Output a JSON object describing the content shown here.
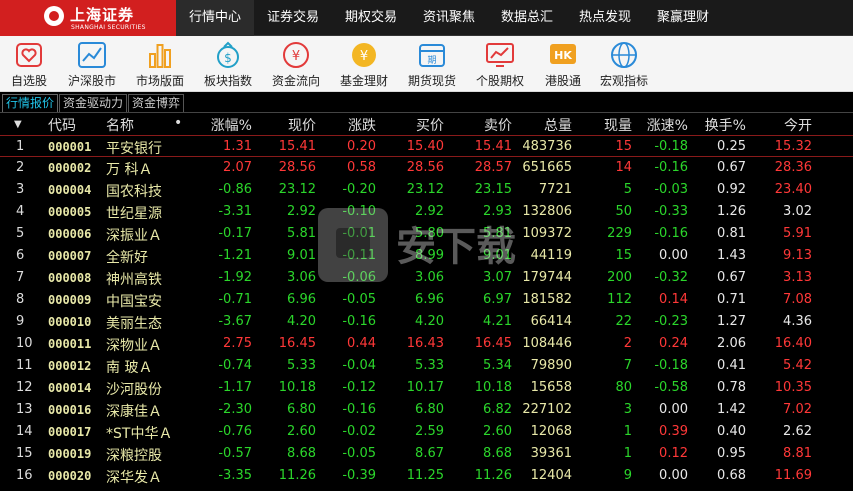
{
  "brand": {
    "name": "上海证券",
    "sub": "SHANGHAI SECURITIES"
  },
  "nav": [
    "行情中心",
    "证券交易",
    "期权交易",
    "资讯聚焦",
    "数据总汇",
    "热点发现",
    "聚赢理财"
  ],
  "toolbar": [
    "自选股",
    "沪深股市",
    "市场版面",
    "板块指数",
    "资金流向",
    "基金理财",
    "期货现货",
    "个股期权",
    "港股通",
    "宏观指标"
  ],
  "subtabs": [
    "行情报价",
    "资金驱动力",
    "资金博弈"
  ],
  "columns": [
    "代码",
    "名称",
    "•",
    "涨幅%",
    "现价",
    "涨跌",
    "买价",
    "卖价",
    "总量",
    "现量",
    "涨速%",
    "换手%",
    "今开"
  ],
  "watermark": "安下载",
  "rows": [
    {
      "idx": "1",
      "code": "000001",
      "name": "平安银行",
      "chg_pct": "1.31",
      "price": "15.41",
      "chg": "0.20",
      "bid": "15.40",
      "ask": "15.41",
      "vol": "483736",
      "cur": "15",
      "speed": "-0.18",
      "turn": "0.25",
      "open": "15.32"
    },
    {
      "idx": "2",
      "code": "000002",
      "name": "万 科Ａ",
      "chg_pct": "2.07",
      "price": "28.56",
      "chg": "0.58",
      "bid": "28.56",
      "ask": "28.57",
      "vol": "651665",
      "cur": "14",
      "speed": "-0.16",
      "turn": "0.67",
      "open": "28.36"
    },
    {
      "idx": "3",
      "code": "000004",
      "name": "国农科技",
      "chg_pct": "-0.86",
      "price": "23.12",
      "chg": "-0.20",
      "bid": "23.12",
      "ask": "23.15",
      "vol": "7721",
      "cur": "5",
      "speed": "-0.03",
      "turn": "0.92",
      "open": "23.40"
    },
    {
      "idx": "4",
      "code": "000005",
      "name": "世纪星源",
      "chg_pct": "-3.31",
      "price": "2.92",
      "chg": "-0.10",
      "bid": "2.92",
      "ask": "2.93",
      "vol": "132806",
      "cur": "50",
      "speed": "-0.33",
      "turn": "1.26",
      "open": "3.02"
    },
    {
      "idx": "5",
      "code": "000006",
      "name": "深振业Ａ",
      "chg_pct": "-0.17",
      "price": "5.81",
      "chg": "-0.01",
      "bid": "5.80",
      "ask": "5.81",
      "vol": "109372",
      "cur": "229",
      "speed": "-0.16",
      "turn": "0.81",
      "open": "5.91"
    },
    {
      "idx": "6",
      "code": "000007",
      "name": "全新好",
      "chg_pct": "-1.21",
      "price": "9.01",
      "chg": "-0.11",
      "bid": "8.99",
      "ask": "9.01",
      "vol": "44119",
      "cur": "15",
      "speed": "0.00",
      "turn": "1.43",
      "open": "9.13"
    },
    {
      "idx": "7",
      "code": "000008",
      "name": "神州高铁",
      "chg_pct": "-1.92",
      "price": "3.06",
      "chg": "-0.06",
      "bid": "3.06",
      "ask": "3.07",
      "vol": "179744",
      "cur": "200",
      "speed": "-0.32",
      "turn": "0.67",
      "open": "3.13"
    },
    {
      "idx": "8",
      "code": "000009",
      "name": "中国宝安",
      "chg_pct": "-0.71",
      "price": "6.96",
      "chg": "-0.05",
      "bid": "6.96",
      "ask": "6.97",
      "vol": "181582",
      "cur": "112",
      "speed": "0.14",
      "turn": "0.71",
      "open": "7.08"
    },
    {
      "idx": "9",
      "code": "000010",
      "name": "美丽生态",
      "chg_pct": "-3.67",
      "price": "4.20",
      "chg": "-0.16",
      "bid": "4.20",
      "ask": "4.21",
      "vol": "66414",
      "cur": "22",
      "speed": "-0.23",
      "turn": "1.27",
      "open": "4.36"
    },
    {
      "idx": "10",
      "code": "000011",
      "name": "深物业Ａ",
      "chg_pct": "2.75",
      "price": "16.45",
      "chg": "0.44",
      "bid": "16.43",
      "ask": "16.45",
      "vol": "108446",
      "cur": "2",
      "speed": "0.24",
      "turn": "2.06",
      "open": "16.40"
    },
    {
      "idx": "11",
      "code": "000012",
      "name": "南 玻Ａ",
      "chg_pct": "-0.74",
      "price": "5.33",
      "chg": "-0.04",
      "bid": "5.33",
      "ask": "5.34",
      "vol": "79890",
      "cur": "7",
      "speed": "-0.18",
      "turn": "0.41",
      "open": "5.42"
    },
    {
      "idx": "12",
      "code": "000014",
      "name": "沙河股份",
      "chg_pct": "-1.17",
      "price": "10.18",
      "chg": "-0.12",
      "bid": "10.17",
      "ask": "10.18",
      "vol": "15658",
      "cur": "80",
      "speed": "-0.58",
      "turn": "0.78",
      "open": "10.35"
    },
    {
      "idx": "13",
      "code": "000016",
      "name": "深康佳Ａ",
      "chg_pct": "-2.30",
      "price": "6.80",
      "chg": "-0.16",
      "bid": "6.80",
      "ask": "6.82",
      "vol": "227102",
      "cur": "3",
      "speed": "0.00",
      "turn": "1.42",
      "open": "7.02"
    },
    {
      "idx": "14",
      "code": "000017",
      "name": "*ST中华Ａ",
      "chg_pct": "-0.76",
      "price": "2.60",
      "chg": "-0.02",
      "bid": "2.59",
      "ask": "2.60",
      "vol": "12068",
      "cur": "1",
      "speed": "0.39",
      "turn": "0.40",
      "open": "2.62"
    },
    {
      "idx": "15",
      "code": "000019",
      "name": "深粮控股",
      "chg_pct": "-0.57",
      "price": "8.68",
      "chg": "-0.05",
      "bid": "8.67",
      "ask": "8.68",
      "vol": "39361",
      "cur": "1",
      "speed": "0.12",
      "turn": "0.95",
      "open": "8.81"
    },
    {
      "idx": "16",
      "code": "000020",
      "name": "深华发Ａ",
      "chg_pct": "-3.35",
      "price": "11.26",
      "chg": "-0.39",
      "bid": "11.25",
      "ask": "11.26",
      "vol": "12404",
      "cur": "9",
      "speed": "0.00",
      "turn": "0.68",
      "open": "11.69"
    }
  ],
  "colors": {
    "up": "#ff3838",
    "down": "#2bd62b",
    "accent": "#d21f1f",
    "selected_tab": "#21c4e8"
  }
}
